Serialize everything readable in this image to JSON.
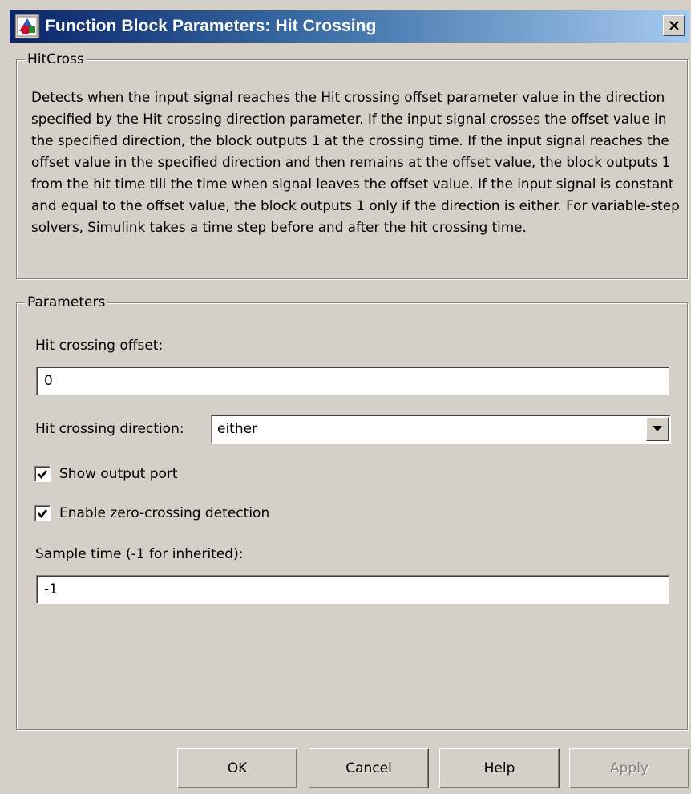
{
  "window": {
    "title": "Function Block Parameters: Hit Crossing",
    "close_label": "Close"
  },
  "description_group": {
    "label": "HitCross",
    "text": "Detects when the input signal reaches the Hit crossing offset parameter value in the direction specified by the Hit crossing direction parameter. If the input signal crosses the offset value in the specified direction, the block outputs 1 at the crossing time. If the input signal reaches the offset value in the specified direction and then remains at the offset value, the block outputs 1 from the hit time till the time when signal leaves the offset value. If the input signal is constant and equal to the offset value, the block outputs 1 only if the direction is either. For variable-step solvers, Simulink takes a time step before and after the hit crossing time."
  },
  "parameters_group": {
    "label": "Parameters",
    "hit_offset": {
      "label": "Hit crossing offset:",
      "value": "0"
    },
    "hit_direction": {
      "label": "Hit crossing direction:",
      "value": "either"
    },
    "show_output_port": {
      "label": "Show output port",
      "checked": true
    },
    "zero_crossing": {
      "label": "Enable zero-crossing detection",
      "checked": true
    },
    "sample_time": {
      "label": "Sample time (-1 for inherited):",
      "value": "-1"
    }
  },
  "buttons": {
    "ok": "OK",
    "cancel": "Cancel",
    "help": "Help",
    "apply": "Apply"
  },
  "colors": {
    "title_gradient_start": "#0a246a",
    "title_gradient_end": "#a6caf0",
    "dialog_background": "#d4d0c8",
    "disabled_text": "#808080"
  },
  "icons": {
    "title_icon": "simulink-block-icon",
    "close_icon": "close-icon",
    "dropdown_icon": "chevron-down-icon",
    "checkmark_icon": "checkmark-icon"
  }
}
